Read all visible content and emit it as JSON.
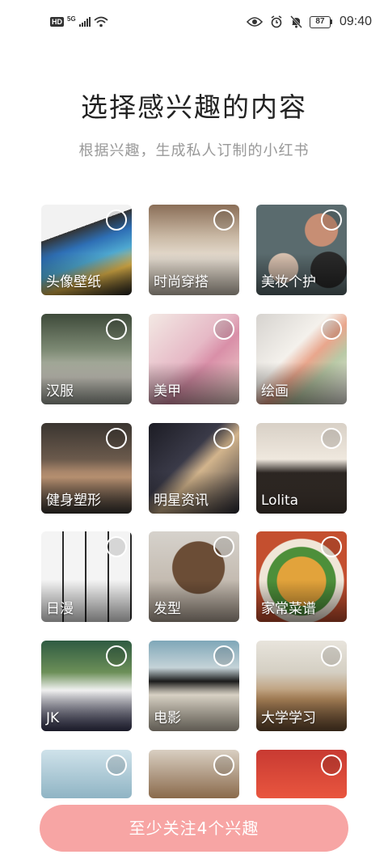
{
  "status_bar": {
    "hd": "HD",
    "network": "5G",
    "battery": "87",
    "time": "09:40"
  },
  "header": {
    "title": "选择感兴趣的内容",
    "subtitle": "根据兴趣，生成私人订制的小红书"
  },
  "interests": [
    {
      "label": "头像壁纸"
    },
    {
      "label": "时尚穿搭"
    },
    {
      "label": "美妆个护"
    },
    {
      "label": "汉服"
    },
    {
      "label": "美甲"
    },
    {
      "label": "绘画"
    },
    {
      "label": "健身塑形"
    },
    {
      "label": "明星资讯"
    },
    {
      "label": "Lolita"
    },
    {
      "label": "日漫"
    },
    {
      "label": "发型"
    },
    {
      "label": "家常菜谱"
    },
    {
      "label": "JK"
    },
    {
      "label": "电影"
    },
    {
      "label": "大学学习"
    }
  ],
  "cta": {
    "label": "至少关注4个兴趣"
  },
  "colors": {
    "cta_bg": "#f7a5a4",
    "subtitle": "#999999",
    "title": "#222222"
  }
}
